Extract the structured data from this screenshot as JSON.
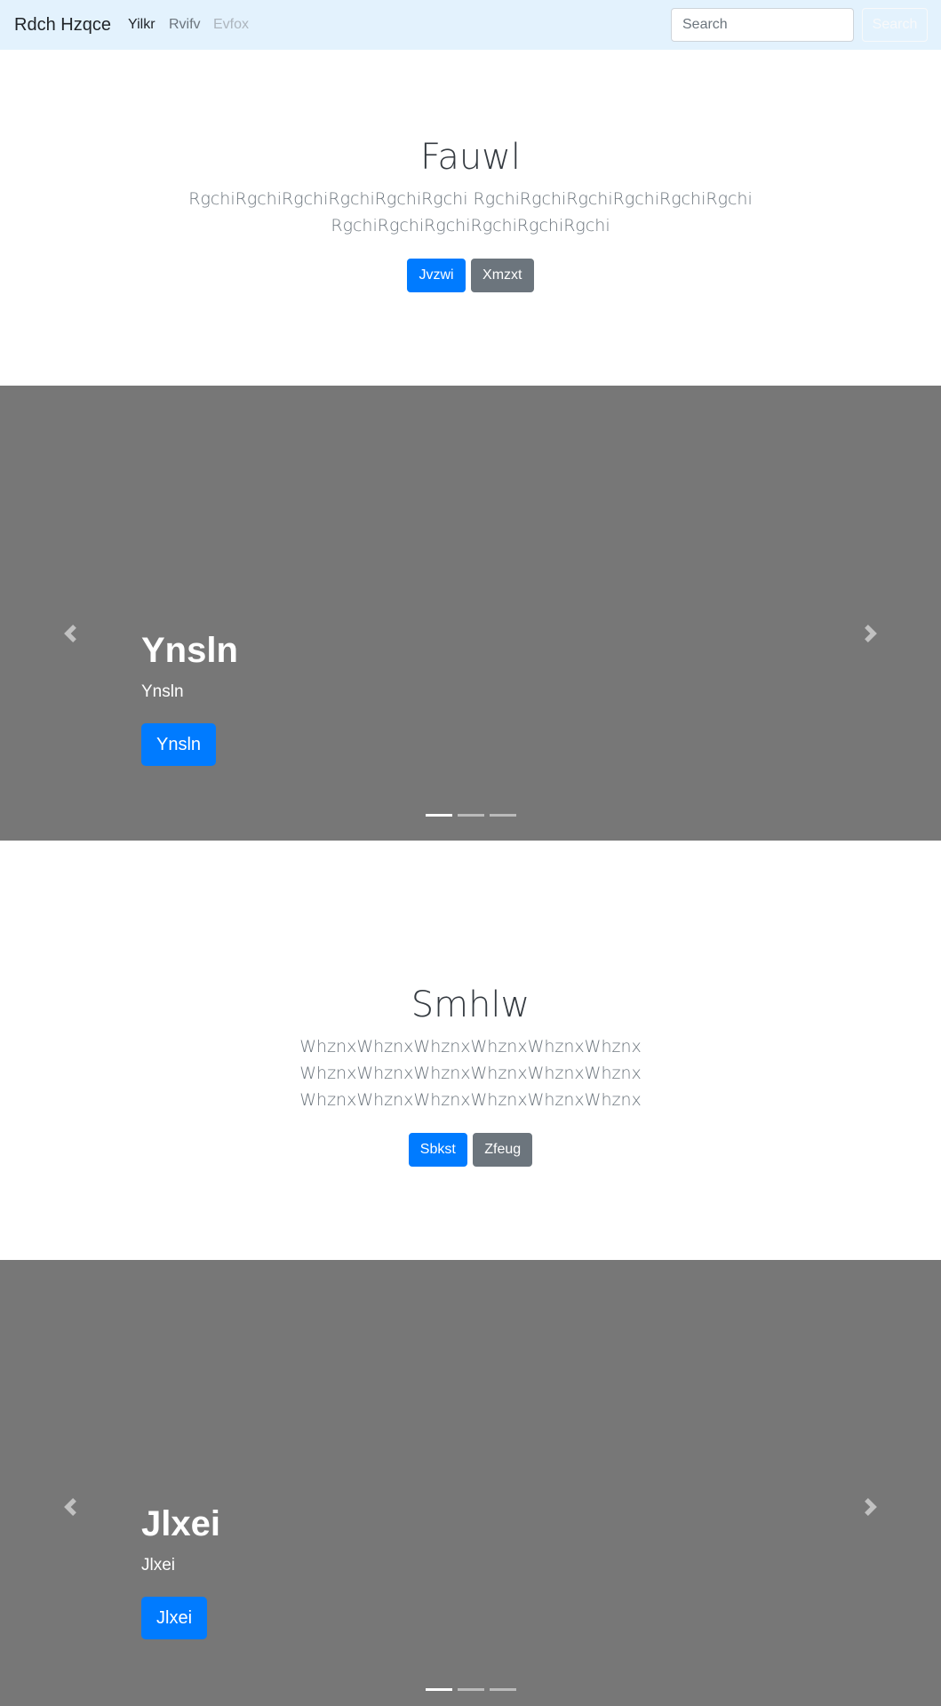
{
  "navbar": {
    "brand": "Rdch Hzqce",
    "links": [
      {
        "label": "Yilkr",
        "state": "active"
      },
      {
        "label": "Rvifv",
        "state": "normal"
      },
      {
        "label": "Evfox",
        "state": "disabled"
      }
    ],
    "search_placeholder": "Search",
    "search_button": "Search"
  },
  "jumbo1": {
    "title": "Fauwl",
    "lead_line1": "RgchiRgchiRgchiRgchiRgchiRgchi RgchiRgchiRgchiRgchiRgchiRgchi",
    "lead_line2": "RgchiRgchiRgchiRgchiRgchiRgchi",
    "primary_button": "Jvzwi",
    "secondary_button": "Xmzxt"
  },
  "carousel1": {
    "heading": "Ynsln",
    "text": "Ynsln",
    "button": "Ynsln",
    "indicator_count": 3,
    "active_indicator": 0
  },
  "jumbo2": {
    "title": "Smhlw",
    "lead_line1": "WhznxWhznxWhznxWhznxWhznxWhznx",
    "lead_line2": "WhznxWhznxWhznxWhznxWhznxWhznx",
    "lead_line3": "WhznxWhznxWhznxWhznxWhznxWhznx",
    "primary_button": "Sbkst",
    "secondary_button": "Zfeug"
  },
  "carousel2": {
    "heading": "Jlxei",
    "text": "Jlxei",
    "button": "Jlxei",
    "indicator_count": 3,
    "active_indicator": 0
  },
  "colors": {
    "navbar_bg": "#e3f2fd",
    "carousel_bg": "#777777",
    "primary": "#007bff",
    "secondary": "#6c757d"
  }
}
